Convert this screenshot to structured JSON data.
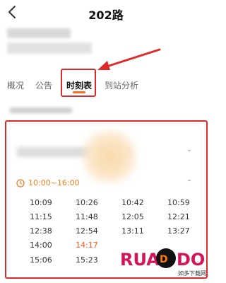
{
  "header": {
    "title": "202路",
    "back_icon": "back-chevron-icon"
  },
  "tabs": [
    {
      "label": "概况",
      "active": false
    },
    {
      "label": "公告",
      "active": false
    },
    {
      "label": "时刻表",
      "active": true
    },
    {
      "label": "到站分析",
      "active": false
    }
  ],
  "timetable": {
    "range_label": "10:00~16:00",
    "times": [
      [
        "10:09",
        "10:26",
        "10:42",
        "10:59"
      ],
      [
        "11:15",
        "11:48",
        "12:05",
        "12:21"
      ],
      [
        "12:38",
        "12:54",
        "13:11",
        "13:27"
      ],
      [
        "14:00",
        "14:17",
        "",
        ""
      ],
      [
        "15:06",
        "15:23",
        "",
        ""
      ]
    ],
    "highlight_time": "14:17"
  },
  "colors": {
    "accent": "#ff6a1a",
    "annotation_red": "#e02a2a",
    "time_range": "#f08020"
  },
  "watermark": {
    "logo_text": "RUANDADO",
    "sub_text": "如多下载网",
    "url": "www.ruandado.com"
  }
}
